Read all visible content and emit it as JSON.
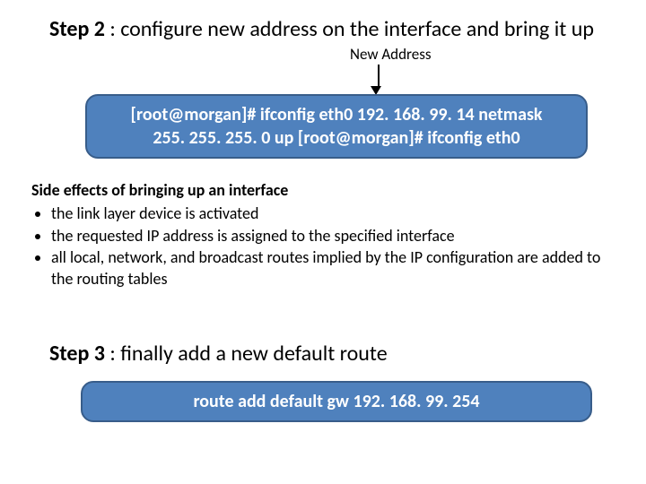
{
  "step2": {
    "label": "Step 2",
    "rest": " : configure new address on the interface and bring it up"
  },
  "newAddressLabel": "New Address",
  "command1": {
    "line1": "[root@morgan]# ifconfig eth0 192. 168. 99. 14 netmask",
    "line2": "255. 255. 255. 0 up [root@morgan]# ifconfig eth0"
  },
  "sideEffects": {
    "heading": "Side effects of bringing up an interface",
    "items": [
      "the link layer device is activated",
      "the requested IP address is assigned to the specified interface",
      "all local, network, and broadcast routes implied by the IP configuration are added to the routing tables"
    ]
  },
  "step3": {
    "label": "Step 3",
    "rest": " : finally add a new default route"
  },
  "command2": "route add default gw 192. 168. 99. 254"
}
